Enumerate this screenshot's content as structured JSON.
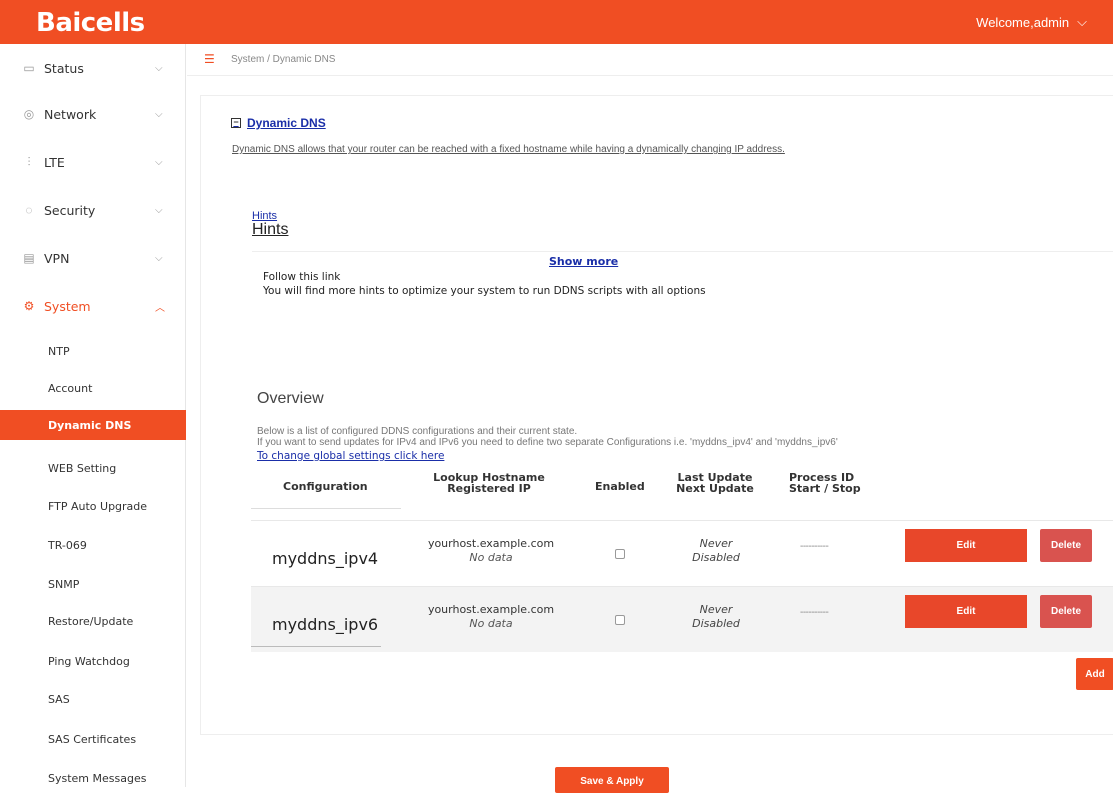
{
  "header": {
    "logo": "Baicells",
    "welcome": "Welcome,admin"
  },
  "sidebar": {
    "items": [
      {
        "label": "Status",
        "icon": "monitor-icon"
      },
      {
        "label": "Network",
        "icon": "globe-icon"
      },
      {
        "label": "LTE",
        "icon": "signal-icon"
      },
      {
        "label": "Security",
        "icon": "shield-icon"
      },
      {
        "label": "VPN",
        "icon": "vpn-icon"
      },
      {
        "label": "System",
        "icon": "gear-icon",
        "active": true
      }
    ],
    "sub_items": [
      {
        "label": "NTP"
      },
      {
        "label": "Account"
      },
      {
        "label": "Dynamic DNS",
        "active": true
      },
      {
        "label": "WEB Setting"
      },
      {
        "label": "FTP Auto Upgrade"
      },
      {
        "label": "TR-069"
      },
      {
        "label": "SNMP"
      },
      {
        "label": "Restore/Update"
      },
      {
        "label": "Ping Watchdog"
      },
      {
        "label": "SAS"
      },
      {
        "label": "SAS Certificates"
      },
      {
        "label": "System Messages"
      }
    ]
  },
  "breadcrumb": "System / Dynamic DNS",
  "section": {
    "title": "Dynamic DNS",
    "description": "Dynamic DNS allows that your router can be reached with a fixed hostname while having a dynamically changing IP address."
  },
  "hints": {
    "link": "Hints",
    "title": "Hints",
    "show_more": "Show more",
    "line1": "Follow this link",
    "line2": "You will find more hints to optimize your system to run DDNS scripts with all options"
  },
  "overview": {
    "title": "Overview",
    "desc1": "Below is a list of configured DDNS configurations and their current state.",
    "desc2": "If you want to send updates for IPv4 and IPv6 you need to define two separate Configurations i.e. 'myddns_ipv4' and 'myddns_ipv6'",
    "global_link": "To change global settings click here"
  },
  "table": {
    "headers": {
      "configuration": "Configuration",
      "lookup1": "Lookup Hostname",
      "lookup2": "Registered IP",
      "enabled": "Enabled",
      "update1": "Last Update",
      "update2": "Next Update",
      "pid1": "Process ID",
      "pid2": "Start / Stop"
    },
    "rows": [
      {
        "name": "myddns_ipv4",
        "host": "yourhost.example.com",
        "ip": "No data",
        "enabled": false,
        "last": "Never",
        "next": "Disabled",
        "pid": "----------",
        "edit": "Edit",
        "delete": "Delete"
      },
      {
        "name": "myddns_ipv6",
        "host": "yourhost.example.com",
        "ip": "No data",
        "enabled": false,
        "last": "Never",
        "next": "Disabled",
        "pid": "----------",
        "edit": "Edit",
        "delete": "Delete"
      }
    ]
  },
  "buttons": {
    "add": "Add",
    "save_apply": "Save & Apply"
  },
  "colors": {
    "brand": "#f04e23",
    "link": "#1a2ea8",
    "delete": "#d9534f"
  }
}
